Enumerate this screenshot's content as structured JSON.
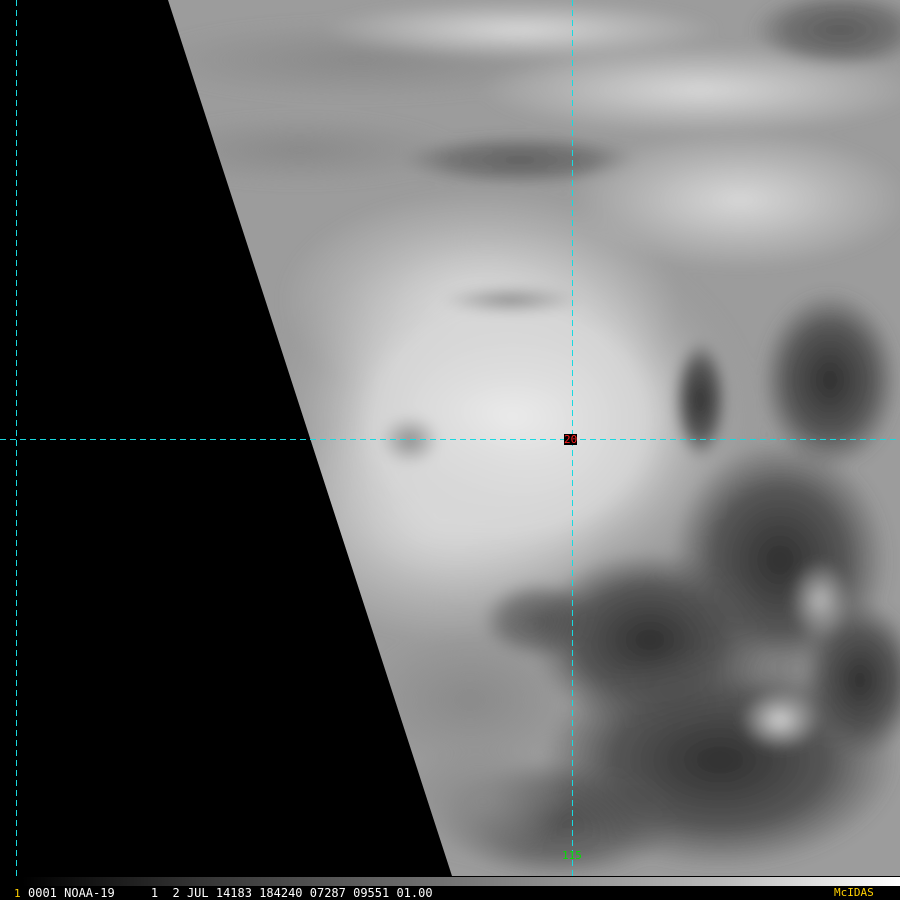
{
  "image": {
    "type": "satellite_infrared",
    "colors": {
      "background": "#000000",
      "grid": "#19d9e0",
      "lat_label": "#ff2020",
      "lon_label": "#00e000",
      "brand": "#ffd000",
      "cloud_bright": "#e6e6e6",
      "cloud_dark": "#3a3a3a"
    }
  },
  "grid": {
    "lat_label": "20",
    "lon_label": "115"
  },
  "status": {
    "frame": "1",
    "text": "0001 NOAA-19     1  2 JUL 14183 184240 07287 09551 01.00",
    "brand": "McIDAS"
  }
}
